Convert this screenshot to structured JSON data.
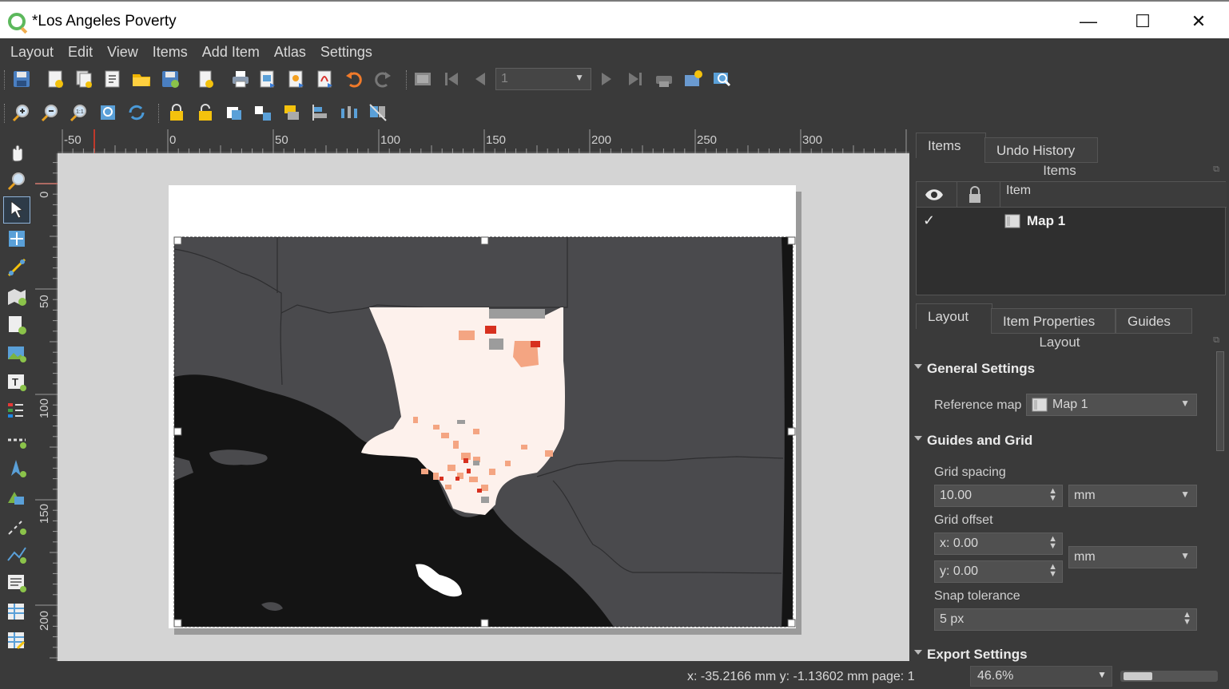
{
  "window": {
    "title": "*Los Angeles Poverty",
    "minimize": "—",
    "maximize": "☐",
    "close": "✕"
  },
  "menu": [
    "Layout",
    "Edit",
    "View",
    "Items",
    "Add Item",
    "Atlas",
    "Settings"
  ],
  "atlas": {
    "page_value": "1"
  },
  "ruler": {
    "h_labels": [
      "-50",
      "0",
      "50",
      "100",
      "150",
      "200",
      "250",
      "300"
    ],
    "v_labels": [
      "0",
      "50",
      "100",
      "150",
      "200"
    ]
  },
  "status": {
    "coords": "x: -35.2166 mm y: -1.13602 mm page: 1",
    "zoom": "46.6%"
  },
  "dock_top": {
    "tabs": [
      "Items",
      "Undo History"
    ],
    "title": "Items",
    "column_header": "Item",
    "items": [
      {
        "name": "Map 1",
        "visible": true
      }
    ]
  },
  "dock_bottom": {
    "tabs": [
      "Layout",
      "Item Properties",
      "Guides"
    ],
    "title": "Layout",
    "general_settings": "General Settings",
    "reference_map_label": "Reference map",
    "reference_map_value": "Map 1",
    "guides_and_grid": "Guides and Grid",
    "grid_spacing_label": "Grid spacing",
    "grid_spacing_value": "10.00",
    "grid_spacing_unit": "mm",
    "grid_offset_label": "Grid offset",
    "grid_offset_x": "x: 0.00",
    "grid_offset_y": "y: 0.00",
    "grid_offset_unit": "mm",
    "snap_tolerance_label": "Snap tolerance",
    "snap_tolerance_value": "5 px",
    "export_settings": "Export Settings"
  },
  "colors": {
    "ui_bg": "#3a3a3a",
    "canvas_bg": "#d4d4d4",
    "map_dark": "#141414",
    "county_gray": "#4a4a4d",
    "la_fill": "#fdf1ec",
    "poverty_high": "#d7301f",
    "poverty_mid": "#f4a582"
  }
}
